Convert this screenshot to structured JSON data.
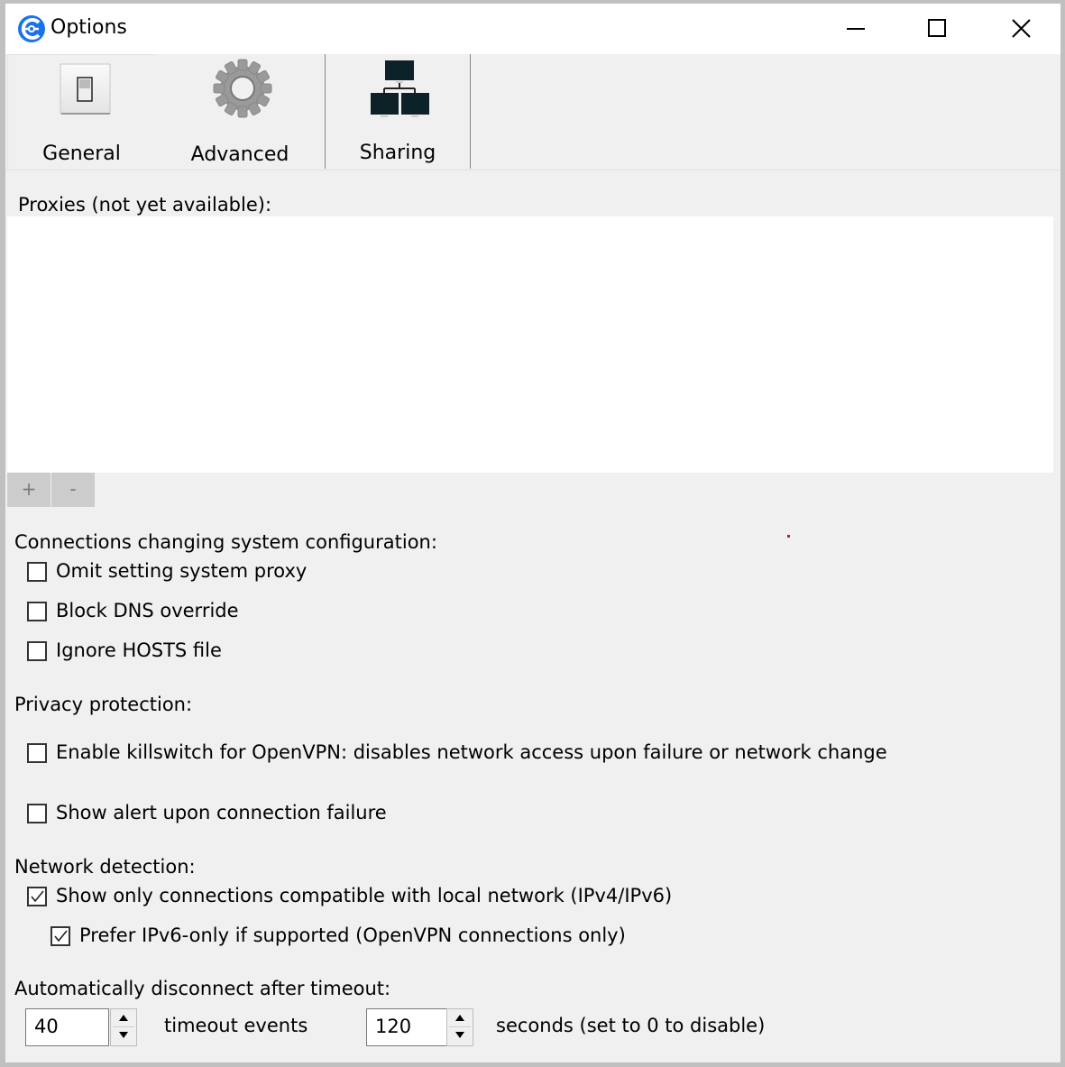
{
  "window": {
    "title": "Options",
    "app_icon": "vpn-app-icon",
    "controls": {
      "minimize": "minimize-icon",
      "maximize": "maximize-icon",
      "close": "close-icon"
    }
  },
  "tabs": [
    {
      "label": "General",
      "icon": "switch-icon",
      "selected": false
    },
    {
      "label": "Advanced",
      "icon": "gear-icon",
      "selected": true
    },
    {
      "label": "Sharing",
      "icon": "network-icon",
      "selected": false
    }
  ],
  "proxies": {
    "label": "Proxies (not yet available):",
    "items": [],
    "add_label": "+",
    "remove_label": "-"
  },
  "system_config": {
    "label": "Connections changing system configuration:",
    "options": [
      {
        "label": "Omit setting system proxy",
        "checked": false
      },
      {
        "label": "Block DNS override",
        "checked": false
      },
      {
        "label": "Ignore HOSTS file",
        "checked": false
      }
    ]
  },
  "privacy": {
    "label": "Privacy protection:",
    "options": [
      {
        "label": "Enable killswitch for OpenVPN: disables network access upon failure or network change",
        "checked": false
      },
      {
        "label": "Show alert upon connection failure",
        "checked": false
      }
    ]
  },
  "network_detection": {
    "label": "Network detection:",
    "options": [
      {
        "label": "Show only connections compatible with local network (IPv4/IPv6)",
        "checked": true
      },
      {
        "label": "Prefer IPv6-only if supported (OpenVPN connections only)",
        "checked": true
      }
    ]
  },
  "timeout": {
    "label": "Automatically disconnect after timeout:",
    "events_value": "40",
    "events_label": "timeout events",
    "seconds_value": "120",
    "seconds_label": "seconds (set to 0 to disable)"
  },
  "colors": {
    "accent": "#1a73e8",
    "window_bg": "#f0f0f0",
    "border": "#c0c0c0"
  }
}
